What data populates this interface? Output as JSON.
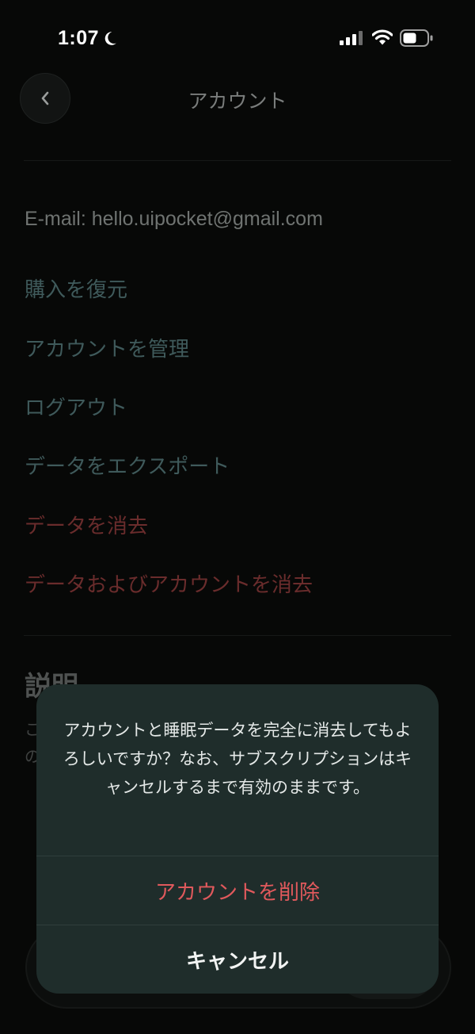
{
  "status_bar": {
    "time": "1:07"
  },
  "header": {
    "title": "アカウント",
    "back_icon": "chevron-left-icon"
  },
  "account": {
    "email": "E-mail: hello.uipocket@gmail.com"
  },
  "menu": {
    "restore_purchases": "購入を復元",
    "manage_account": "アカウントを管理",
    "logout": "ログアウト",
    "export_data": "データをエクスポート",
    "delete_data": "データを消去",
    "delete_data_and_account": "データおよびアカウントを消去"
  },
  "description": {
    "title": "説明",
    "text_line1": "こ",
    "text_line2": "の"
  },
  "alert": {
    "message": "アカウントと睡眠データを完全に消去してもよろしいですか？なお、サブスクリプションはキャンセルするまで有効のままです。",
    "destructive_label": "アカウントを削除",
    "cancel_label": "キャンセル"
  },
  "colors": {
    "accent_teal": "#3f5a5b",
    "destructive_red": "#e0595c",
    "dialog_background": "#1f2d2b"
  }
}
